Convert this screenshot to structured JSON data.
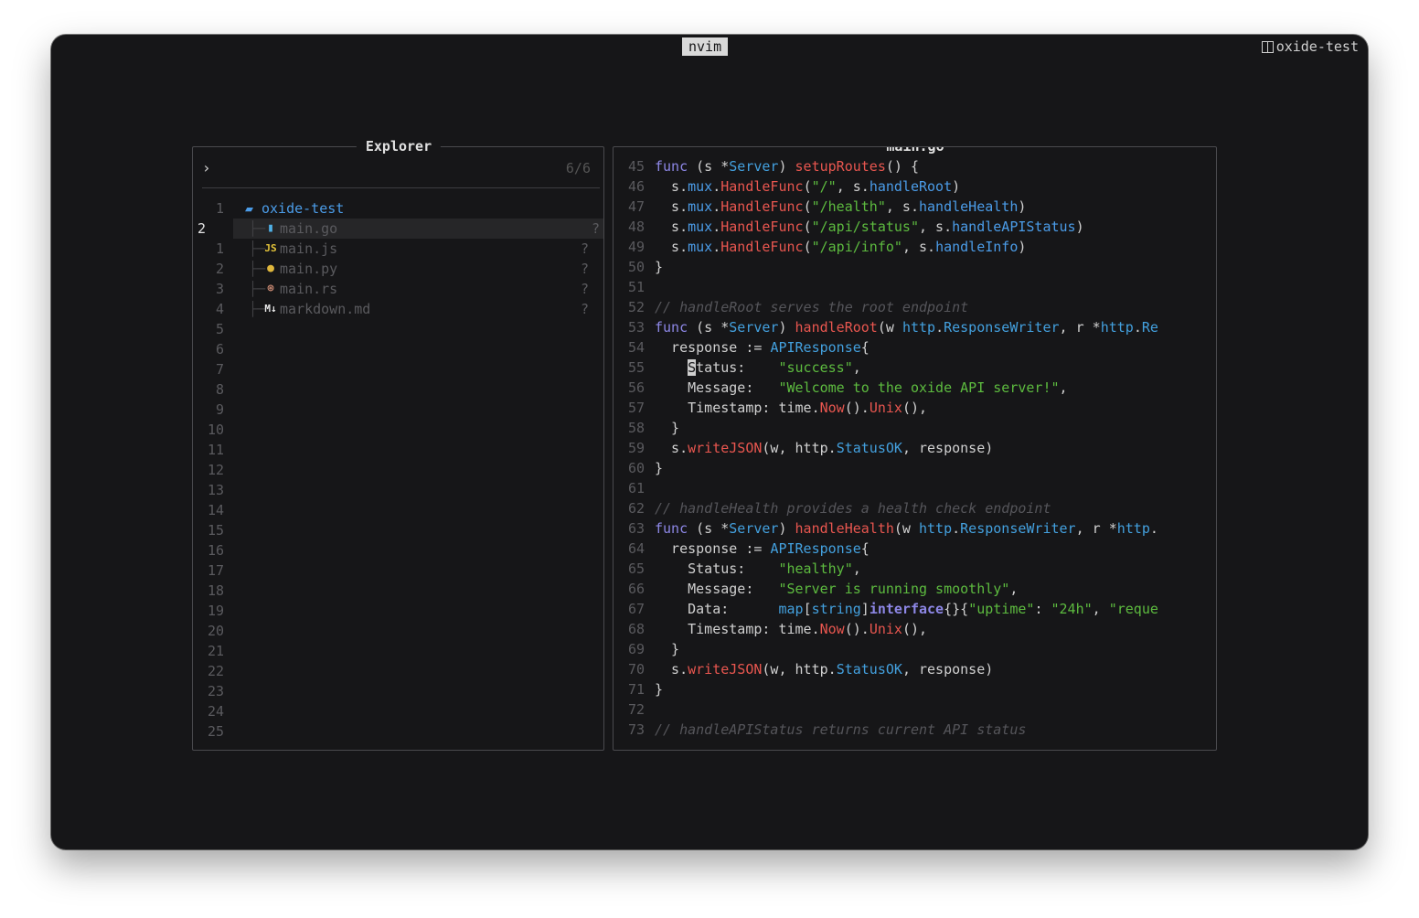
{
  "titlebar": {
    "app": "nvim",
    "session": "oxide-test"
  },
  "explorer": {
    "title": "Explorer",
    "prompt_icon": "›",
    "count": "6/6",
    "root": {
      "name": "oxide-test",
      "icon": "folder-icon"
    },
    "root_line": "1",
    "files": [
      {
        "line": "2",
        "name": "main.go",
        "icon": "go-file-icon",
        "status": "?",
        "current": true
      },
      {
        "line": "1",
        "name": "main.js",
        "icon": "js-file-icon",
        "status": "?"
      },
      {
        "line": "2",
        "name": "main.py",
        "icon": "python-file-icon",
        "status": "?"
      },
      {
        "line": "3",
        "name": "main.rs",
        "icon": "rust-file-icon",
        "status": "?"
      },
      {
        "line": "4",
        "name": "markdown.md",
        "icon": "markdown-file-icon",
        "status": "?"
      }
    ],
    "empty_lines": [
      "5",
      "6",
      "7",
      "8",
      "9",
      "10",
      "11",
      "12",
      "13",
      "14",
      "15",
      "16",
      "17",
      "18",
      "19",
      "20",
      "21",
      "22",
      "23",
      "24",
      "25"
    ]
  },
  "editor": {
    "title": "main.go",
    "lines": [
      {
        "n": "45",
        "tokens": [
          [
            "k",
            "func"
          ],
          [
            "p",
            " (s *"
          ],
          [
            "t",
            "Server"
          ],
          [
            "p",
            ") "
          ],
          [
            "f",
            "setupRoutes"
          ],
          [
            "p",
            "() {"
          ]
        ]
      },
      {
        "n": "46",
        "tokens": [
          [
            "p",
            "  s."
          ],
          [
            "m",
            "mux"
          ],
          [
            "p",
            "."
          ],
          [
            "f",
            "HandleFunc"
          ],
          [
            "p",
            "("
          ],
          [
            "s",
            "\"/\""
          ],
          [
            "p",
            ", s."
          ],
          [
            "m",
            "handleRoot"
          ],
          [
            "p",
            ")"
          ]
        ]
      },
      {
        "n": "47",
        "tokens": [
          [
            "p",
            "  s."
          ],
          [
            "m",
            "mux"
          ],
          [
            "p",
            "."
          ],
          [
            "f",
            "HandleFunc"
          ],
          [
            "p",
            "("
          ],
          [
            "s",
            "\"/health\""
          ],
          [
            "p",
            ", s."
          ],
          [
            "m",
            "handleHealth"
          ],
          [
            "p",
            ")"
          ]
        ]
      },
      {
        "n": "48",
        "tokens": [
          [
            "p",
            "  s."
          ],
          [
            "m",
            "mux"
          ],
          [
            "p",
            "."
          ],
          [
            "f",
            "HandleFunc"
          ],
          [
            "p",
            "("
          ],
          [
            "s",
            "\"/api/status\""
          ],
          [
            "p",
            ", s."
          ],
          [
            "m",
            "handleAPIStatus"
          ],
          [
            "p",
            ")"
          ]
        ]
      },
      {
        "n": "49",
        "tokens": [
          [
            "p",
            "  s."
          ],
          [
            "m",
            "mux"
          ],
          [
            "p",
            "."
          ],
          [
            "f",
            "HandleFunc"
          ],
          [
            "p",
            "("
          ],
          [
            "s",
            "\"/api/info\""
          ],
          [
            "p",
            ", s."
          ],
          [
            "m",
            "handleInfo"
          ],
          [
            "p",
            ")"
          ]
        ]
      },
      {
        "n": "50",
        "tokens": [
          [
            "p",
            "}"
          ]
        ]
      },
      {
        "n": "51",
        "tokens": []
      },
      {
        "n": "52",
        "tokens": [
          [
            "c",
            "// handleRoot serves the root endpoint"
          ]
        ]
      },
      {
        "n": "53",
        "tokens": [
          [
            "k",
            "func"
          ],
          [
            "p",
            " (s *"
          ],
          [
            "t",
            "Server"
          ],
          [
            "p",
            ") "
          ],
          [
            "f",
            "handleRoot"
          ],
          [
            "p",
            "(w "
          ],
          [
            "t",
            "http"
          ],
          [
            "p",
            "."
          ],
          [
            "t",
            "ResponseWriter"
          ],
          [
            "p",
            ", r *"
          ],
          [
            "t",
            "http"
          ],
          [
            "p",
            "."
          ],
          [
            "t",
            "Re"
          ]
        ]
      },
      {
        "n": "54",
        "tokens": [
          [
            "p",
            "  response := "
          ],
          [
            "t",
            "APIResponse"
          ],
          [
            "p",
            "{"
          ]
        ]
      },
      {
        "n": "55",
        "tokens": [
          [
            "p",
            "    "
          ],
          [
            "cur",
            "S"
          ],
          [
            "p",
            "tatus:    "
          ],
          [
            "s",
            "\"success\""
          ],
          [
            "p",
            ","
          ]
        ]
      },
      {
        "n": "56",
        "tokens": [
          [
            "p",
            "    Message:   "
          ],
          [
            "s",
            "\"Welcome to the oxide API server!\""
          ],
          [
            "p",
            ","
          ]
        ]
      },
      {
        "n": "57",
        "tokens": [
          [
            "p",
            "    Timestamp: time."
          ],
          [
            "f",
            "Now"
          ],
          [
            "p",
            "()."
          ],
          [
            "f",
            "Unix"
          ],
          [
            "p",
            "(),"
          ]
        ]
      },
      {
        "n": "58",
        "tokens": [
          [
            "p",
            "  }"
          ]
        ]
      },
      {
        "n": "59",
        "tokens": [
          [
            "p",
            "  s."
          ],
          [
            "f",
            "writeJSON"
          ],
          [
            "p",
            "(w, http."
          ],
          [
            "t",
            "StatusOK"
          ],
          [
            "p",
            ", response)"
          ]
        ]
      },
      {
        "n": "60",
        "tokens": [
          [
            "p",
            "}"
          ]
        ]
      },
      {
        "n": "61",
        "tokens": []
      },
      {
        "n": "62",
        "tokens": [
          [
            "c",
            "// handleHealth provides a health check endpoint"
          ]
        ]
      },
      {
        "n": "63",
        "tokens": [
          [
            "k",
            "func"
          ],
          [
            "p",
            " (s *"
          ],
          [
            "t",
            "Server"
          ],
          [
            "p",
            ") "
          ],
          [
            "f",
            "handleHealth"
          ],
          [
            "p",
            "(w "
          ],
          [
            "t",
            "http"
          ],
          [
            "p",
            "."
          ],
          [
            "t",
            "ResponseWriter"
          ],
          [
            "p",
            ", r *"
          ],
          [
            "t",
            "http"
          ],
          [
            "p",
            "."
          ]
        ]
      },
      {
        "n": "64",
        "tokens": [
          [
            "p",
            "  response := "
          ],
          [
            "t",
            "APIResponse"
          ],
          [
            "p",
            "{"
          ]
        ]
      },
      {
        "n": "65",
        "tokens": [
          [
            "p",
            "    Status:    "
          ],
          [
            "s",
            "\"healthy\""
          ],
          [
            "p",
            ","
          ]
        ]
      },
      {
        "n": "66",
        "tokens": [
          [
            "p",
            "    Message:   "
          ],
          [
            "s",
            "\"Server is running smoothly\""
          ],
          [
            "p",
            ","
          ]
        ]
      },
      {
        "n": "67",
        "tokens": [
          [
            "p",
            "    Data:      "
          ],
          [
            "t",
            "map"
          ],
          [
            "p",
            "["
          ],
          [
            "t",
            "string"
          ],
          [
            "p",
            "]"
          ],
          [
            "b",
            "interface"
          ],
          [
            "p",
            "{}{"
          ],
          [
            "s",
            "\"uptime\""
          ],
          [
            "p",
            ": "
          ],
          [
            "s",
            "\"24h\""
          ],
          [
            "p",
            ", "
          ],
          [
            "s",
            "\"reque"
          ]
        ]
      },
      {
        "n": "68",
        "tokens": [
          [
            "p",
            "    Timestamp: time."
          ],
          [
            "f",
            "Now"
          ],
          [
            "p",
            "()."
          ],
          [
            "f",
            "Unix"
          ],
          [
            "p",
            "(),"
          ]
        ]
      },
      {
        "n": "69",
        "tokens": [
          [
            "p",
            "  }"
          ]
        ]
      },
      {
        "n": "70",
        "tokens": [
          [
            "p",
            "  s."
          ],
          [
            "f",
            "writeJSON"
          ],
          [
            "p",
            "(w, http."
          ],
          [
            "t",
            "StatusOK"
          ],
          [
            "p",
            ", response)"
          ]
        ]
      },
      {
        "n": "71",
        "tokens": [
          [
            "p",
            "}"
          ]
        ]
      },
      {
        "n": "72",
        "tokens": []
      },
      {
        "n": "73",
        "tokens": [
          [
            "c",
            "// handleAPIStatus returns current API status"
          ]
        ]
      }
    ]
  }
}
